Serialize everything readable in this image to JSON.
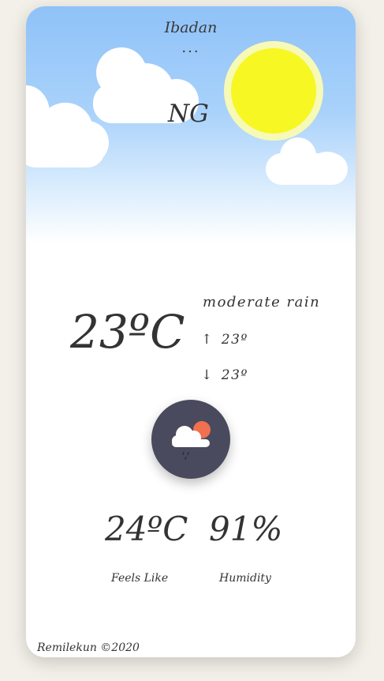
{
  "location": {
    "city": "Ibadan",
    "menu_glyph": "...",
    "country": "NG"
  },
  "weather": {
    "temperature": "23ºC",
    "description": "moderate rain",
    "high_arrow": "↑",
    "high": "23º",
    "low_arrow": "↓",
    "low": "23º",
    "icon": "cloud-sun-rain-icon"
  },
  "stats": {
    "feels_like_value": "24ºC",
    "feels_like_label": "Feels Like",
    "humidity_value": "91%",
    "humidity_label": "Humidity"
  },
  "footer": {
    "credit": "Remilekun ©2020"
  },
  "colors": {
    "sky_top": "#8fc2f8",
    "sun_core": "#f7f724",
    "sun_halo": "#f7f9b6",
    "icon_bg": "#4a4a5e",
    "icon_sun": "#f07050"
  }
}
